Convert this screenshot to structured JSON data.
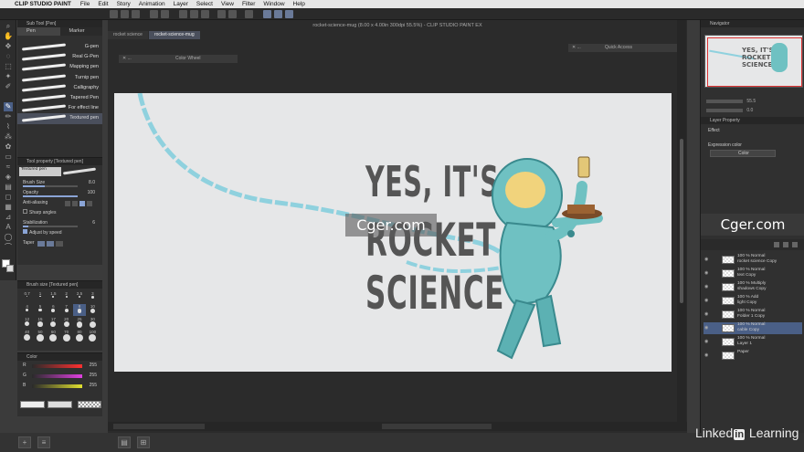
{
  "menubar": {
    "app_name": "CLIP STUDIO PAINT",
    "items": [
      "File",
      "Edit",
      "Story",
      "Animation",
      "Layer",
      "Select",
      "View",
      "Filter",
      "Window",
      "Help"
    ]
  },
  "subtool_panel": {
    "header": "Sub Tool [Pen]",
    "tabs": [
      "Pen",
      "Marker"
    ],
    "brushes": [
      "G-pen",
      "Real G-Pen",
      "Mapping pen",
      "Turnip pen",
      "Calligraphy",
      "Tapered Pen",
      "For effect line",
      "Textured pen"
    ],
    "selected_brush": "Textured pen"
  },
  "tool_property": {
    "header": "Tool property [Textured pen]",
    "brush_label": "Textured pen",
    "brush_size_label": "Brush Size",
    "brush_size_value": "8.0",
    "opacity_label": "Opacity",
    "opacity_value": "100",
    "anti_aliasing_label": "Anti-aliasing",
    "sharp_angles_label": "Sharp angles",
    "stabilization_label": "Stabilization",
    "stabilization_value": "6",
    "adjust_speed_label": "Adjust by speed",
    "taper_label": "Taper"
  },
  "brush_size_panel": {
    "header": "Brush size [Textured pen]",
    "sizes": [
      "0.7",
      "1",
      "1.5",
      "2",
      "2.5",
      "3",
      "4",
      "5",
      "6",
      "7",
      "8",
      "10",
      "12",
      "15",
      "17",
      "20",
      "25",
      "30",
      "40",
      "50",
      "60",
      "70",
      "80",
      "100"
    ],
    "selected": "8"
  },
  "color_panel": {
    "header": "Color",
    "rows": [
      {
        "label": "R",
        "value": "255",
        "color": "#ff3030"
      },
      {
        "label": "G",
        "value": "255",
        "color": "#e040e0"
      },
      {
        "label": "B",
        "value": "255",
        "color": "#e0e030"
      }
    ]
  },
  "document": {
    "title": "rocket-science-mug (8.00 x 4.00in 300dpi 55.5%) - CLIP STUDIO PAINT EX",
    "tabs": [
      "rocket science",
      "rocket-science-mug"
    ],
    "selected_tab": "rocket-science-mug",
    "color_wheel_label": "Color Wheel",
    "quick_access_label": "Quick Access",
    "artwork_lines": [
      "YES, IT'S",
      "ROCKET",
      "SCIENCE"
    ],
    "watermark": "Cger.com"
  },
  "navigator": {
    "header": "Navigator",
    "thumb_lines": [
      "YES, IT'S",
      "ROCKET",
      "SCIENCE"
    ],
    "zoom": "55.5",
    "rotation": "0.0"
  },
  "layer_property": {
    "header": "Layer Property",
    "effect_label": "Effect",
    "expression_label": "Expression color",
    "expression_value": "Color"
  },
  "layers": [
    {
      "pct": "100 %",
      "mode": "Normal",
      "name": "rocket science Copy",
      "selected": false
    },
    {
      "pct": "100 %",
      "mode": "Normal",
      "name": "text Copy",
      "selected": false
    },
    {
      "pct": "100 %",
      "mode": "Multiply",
      "name": "shadows Copy",
      "selected": false
    },
    {
      "pct": "100 %",
      "mode": "Add",
      "name": "light Copy",
      "selected": false
    },
    {
      "pct": "100 %",
      "mode": "Normal",
      "name": "Folder 1 Copy",
      "selected": false
    },
    {
      "pct": "100 %",
      "mode": "Normal",
      "name": "cable Copy",
      "selected": true
    },
    {
      "pct": "100 %",
      "mode": "Normal",
      "name": "Layer 1",
      "selected": false
    },
    {
      "pct": "",
      "mode": "",
      "name": "Paper",
      "selected": false
    }
  ],
  "right_watermark": "Cger.com",
  "brand": {
    "pre": "Linked",
    "in": "in",
    "post": " Learning"
  }
}
